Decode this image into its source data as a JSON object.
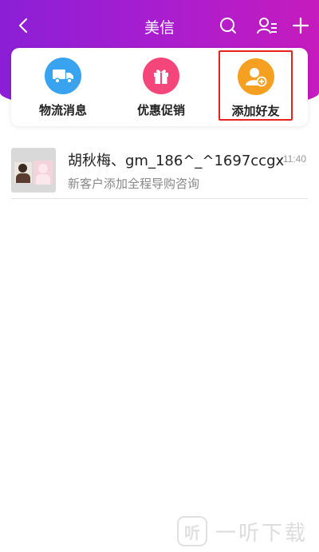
{
  "header": {
    "title": "美信",
    "back_icon": "chevron-left-icon",
    "actions": [
      "search-icon",
      "contacts-icon",
      "plus-icon"
    ],
    "colors": {
      "gradient_start": "#8b1fd6",
      "gradient_end": "#c61bbd"
    }
  },
  "quick_actions": [
    {
      "label": "物流消息",
      "icon": "truck-icon",
      "color": "#3aa3ef"
    },
    {
      "label": "优惠促销",
      "icon": "gift-icon",
      "color": "#f4467a"
    },
    {
      "label": "添加好友",
      "icon": "add-friend-icon",
      "color": "#f5a020",
      "highlighted": true
    }
  ],
  "chats": [
    {
      "name": "胡秋梅、gm_186^_^1697ccgx",
      "time": "11:40",
      "preview": "新客户添加全程导购咨询"
    }
  ],
  "watermark": {
    "text": "一听下载",
    "logo_glyph": "听"
  }
}
